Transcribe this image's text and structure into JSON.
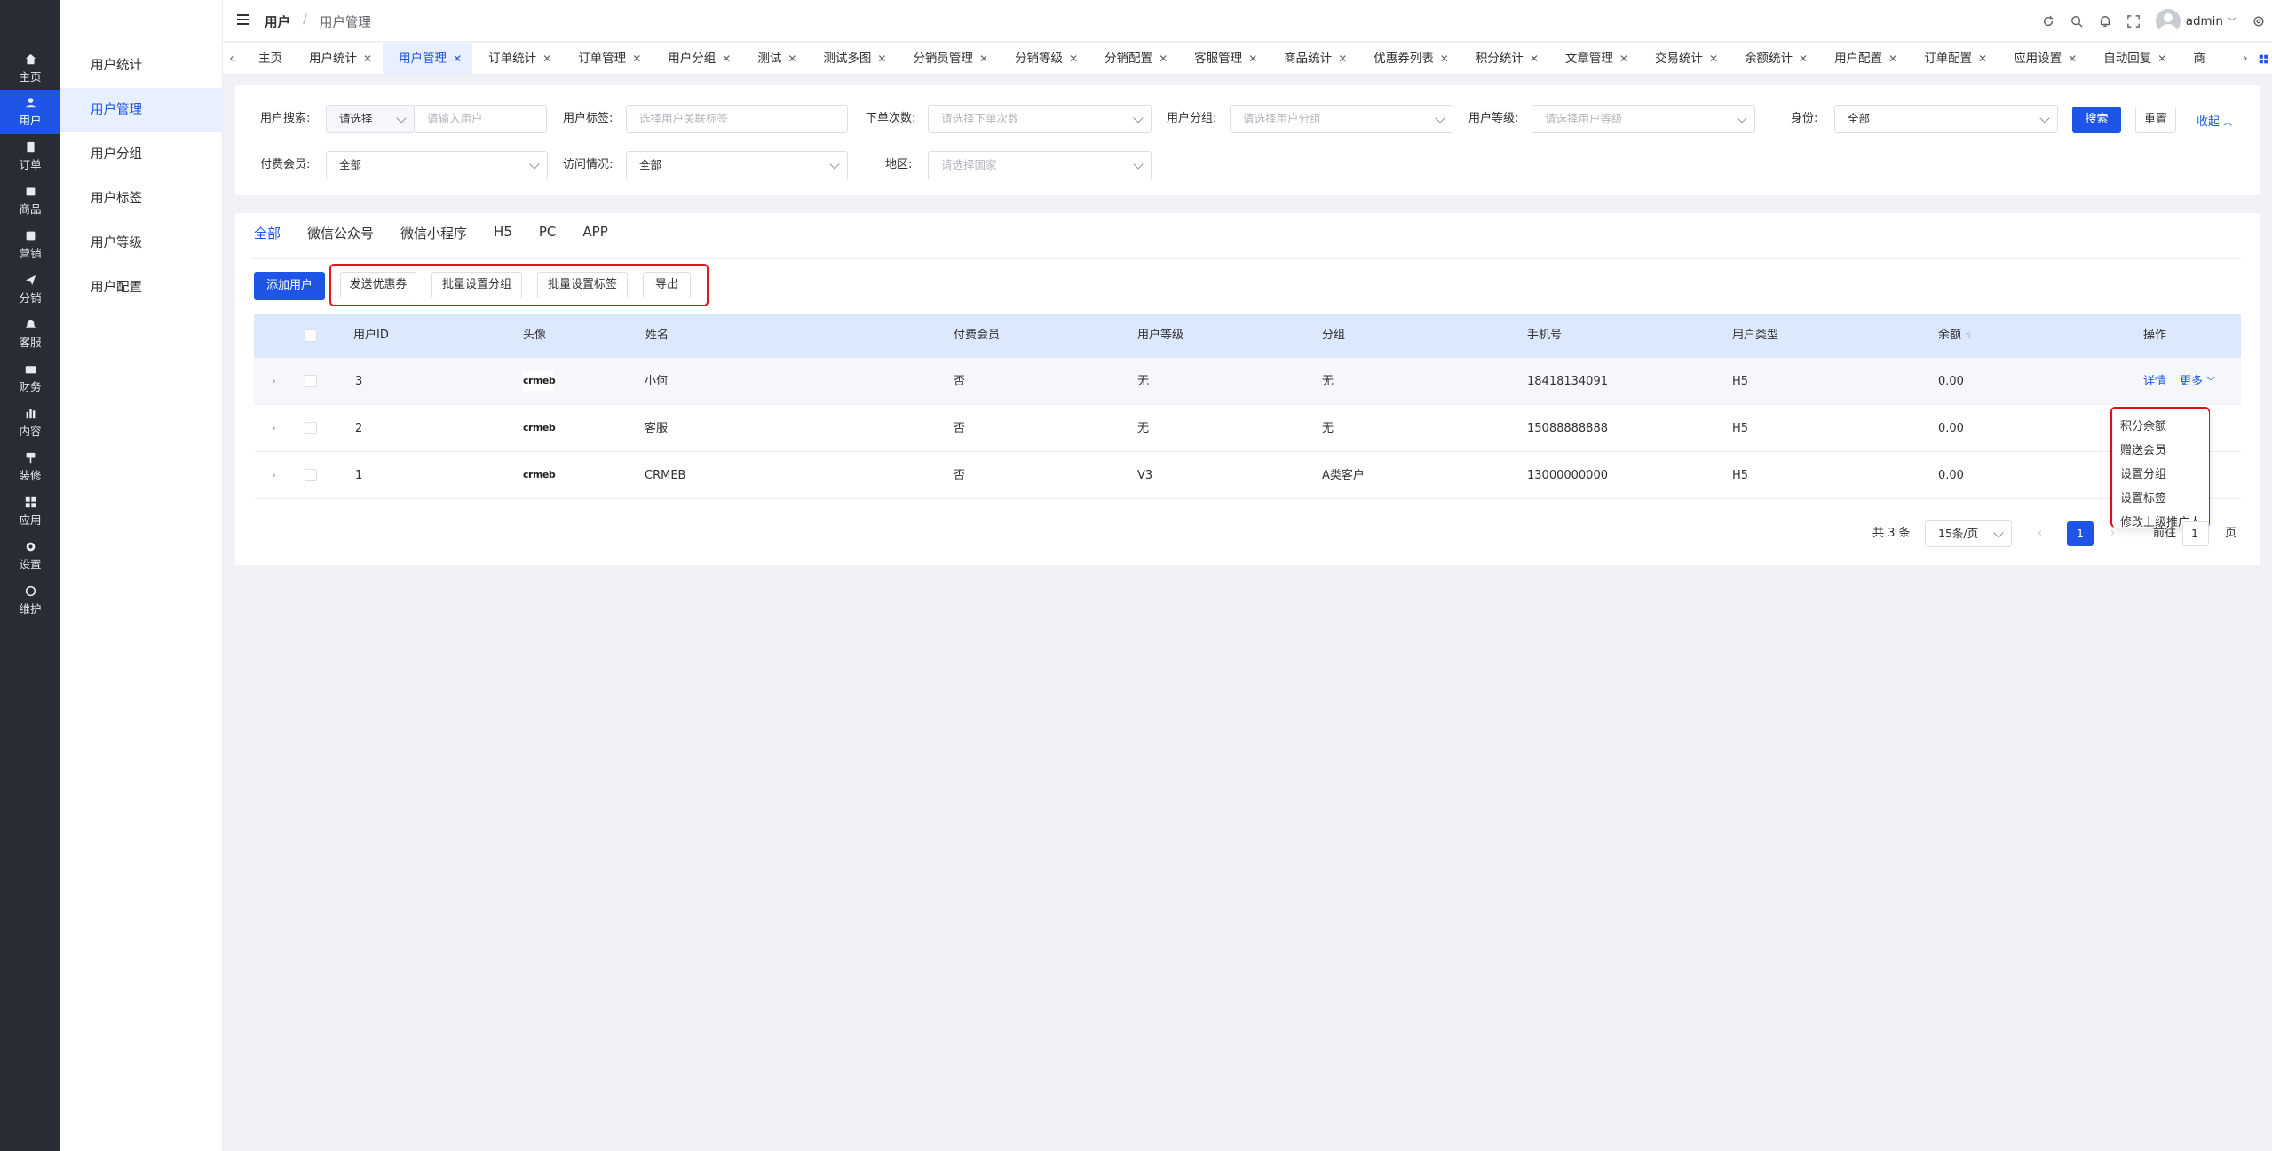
{
  "sidebar": {
    "items": [
      {
        "label": "主页",
        "icon": "home-icon"
      },
      {
        "label": "用户",
        "icon": "user-icon"
      },
      {
        "label": "订单",
        "icon": "order-icon"
      },
      {
        "label": "商品",
        "icon": "product-icon"
      },
      {
        "label": "营销",
        "icon": "marketing-icon"
      },
      {
        "label": "分销",
        "icon": "distribution-icon"
      },
      {
        "label": "客服",
        "icon": "service-icon"
      },
      {
        "label": "财务",
        "icon": "finance-icon"
      },
      {
        "label": "内容",
        "icon": "content-icon"
      },
      {
        "label": "装修",
        "icon": "decorate-icon"
      },
      {
        "label": "应用",
        "icon": "apps-icon"
      },
      {
        "label": "设置",
        "icon": "settings-icon"
      },
      {
        "label": "维护",
        "icon": "maintain-icon"
      }
    ]
  },
  "submenu": {
    "items": [
      "用户统计",
      "用户管理",
      "用户分组",
      "用户标签",
      "用户等级",
      "用户配置"
    ]
  },
  "header": {
    "crumb1": "用户",
    "sep": "/",
    "crumb2": "用户管理",
    "user": "admin"
  },
  "tabs": [
    "主页",
    "用户统计",
    "用户管理",
    "订单统计",
    "订单管理",
    "用户分组",
    "测试",
    "测试多图",
    "分销员管理",
    "分销等级",
    "分销配置",
    "客服管理",
    "商品统计",
    "优惠券列表",
    "积分统计",
    "文章管理",
    "交易统计",
    "余额统计",
    "用户配置",
    "订单配置",
    "应用设置",
    "自动回复",
    "商"
  ],
  "filters": {
    "search_label": "用户搜索:",
    "search_select": "请选择",
    "search_placeholder": "请输入用户",
    "tag_label": "用户标签:",
    "tag_placeholder": "选择用户关联标签",
    "orders_label": "下单次数:",
    "orders_placeholder": "请选择下单次数",
    "group_label": "用户分组:",
    "group_placeholder": "请选择用户分组",
    "level_label": "用户等级:",
    "level_placeholder": "请选择用户等级",
    "identity_label": "身份:",
    "identity_value": "全部",
    "search_btn": "搜索",
    "reset_btn": "重置",
    "collapse_link": "收起",
    "paid_label": "付费会员:",
    "paid_value": "全部",
    "visit_label": "访问情况:",
    "visit_value": "全部",
    "region_label": "地区:",
    "region_placeholder": "请选择国家"
  },
  "channel_tabs": [
    "全部",
    "微信公众号",
    "微信小程序",
    "H5",
    "PC",
    "APP"
  ],
  "actions": {
    "add_user": "添加用户",
    "send_coupon": "发送优惠券",
    "batch_group": "批量设置分组",
    "batch_tag": "批量设置标签",
    "export": "导出"
  },
  "table": {
    "headers": [
      "用户ID",
      "头像",
      "姓名",
      "付费会员",
      "用户等级",
      "分组",
      "手机号",
      "用户类型",
      "余额",
      "操作"
    ],
    "rows": [
      {
        "id": "3",
        "avatar": "crmeb",
        "name": "小何",
        "paid": "否",
        "level": "无",
        "group": "无",
        "phone": "18418134091",
        "type": "H5",
        "balance": "0.00"
      },
      {
        "id": "2",
        "avatar": "crmeb",
        "name": "客服",
        "paid": "否",
        "level": "无",
        "group": "无",
        "phone": "15088888888",
        "type": "H5",
        "balance": "0.00"
      },
      {
        "id": "1",
        "avatar": "crmeb",
        "name": "CRMEB",
        "paid": "否",
        "level": "V3",
        "group": "A类客户",
        "phone": "13000000000",
        "type": "H5",
        "balance": "0.00"
      }
    ],
    "detail_link": "详情",
    "more_link": "更多"
  },
  "more_menu": [
    "积分余额",
    "赠送会员",
    "设置分组",
    "设置标签",
    "修改上级推广人"
  ],
  "pagination": {
    "total": "共 3 条",
    "page_size": "15条/页",
    "current": "1",
    "goto_label": "前往",
    "goto_value": "1",
    "page_suffix": "页"
  },
  "colors": {
    "primary": "#1f55e6",
    "sidebar": "#282c34",
    "highlight": "#e4121b"
  }
}
